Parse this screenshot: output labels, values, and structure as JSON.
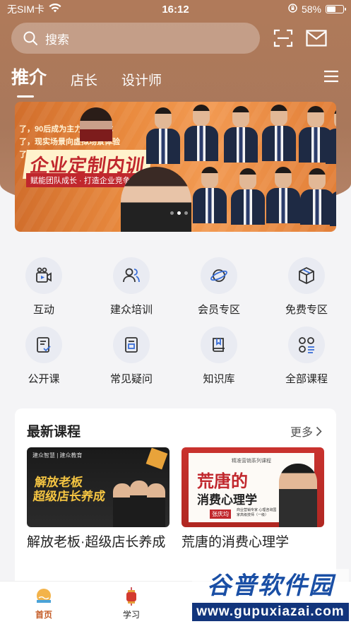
{
  "status_bar": {
    "carrier": "无SIM卡",
    "time": "16:12",
    "battery": "58%",
    "battery_level": 0.58
  },
  "search": {
    "placeholder": "搜索"
  },
  "tabs": [
    {
      "label": "推介",
      "active": true
    },
    {
      "label": "店长",
      "active": false
    },
    {
      "label": "设计师",
      "active": false
    }
  ],
  "banner": {
    "line1": "了，90后成为主力消费群体",
    "line2": "了，现实场景向虚拟场景体验",
    "line3": "了",
    "title": "企业定制内训",
    "subtitle": "赋能团队成长 · 打造企业竞争力",
    "slide_count": 3,
    "active_slide": 1
  },
  "shortcuts": [
    {
      "label": "互动",
      "icon": "video-camera-icon"
    },
    {
      "label": "建众培训",
      "icon": "users-icon"
    },
    {
      "label": "会员专区",
      "icon": "planet-icon"
    },
    {
      "label": "免费专区",
      "icon": "box-icon"
    },
    {
      "label": "公开课",
      "icon": "checklist-icon"
    },
    {
      "label": "常见疑问",
      "icon": "document-icon"
    },
    {
      "label": "知识库",
      "icon": "book-icon"
    },
    {
      "label": "全部课程",
      "icon": "categories-icon"
    }
  ],
  "latest_courses": {
    "heading": "最新课程",
    "more": "更多",
    "items": [
      {
        "title": "解放老板·超级店长养成",
        "thumb_text": "解放老板\n超级店长养成",
        "thumb_logo": "建众智慧 | 建众教育"
      },
      {
        "title": "荒唐的消费心理学",
        "thumb_top": "精准营销系列课程",
        "thumb_big": "荒唐的",
        "thumb_mid": "消费心理学",
        "thumb_name": "张庆均",
        "thumb_desc": "商业营销专家 心理咨询国家高级技师（一级）"
      }
    ]
  },
  "bottom_nav": [
    {
      "label": "首页",
      "active": true
    },
    {
      "label": "学习",
      "active": false
    }
  ],
  "watermark": {
    "top": "谷普软件园",
    "bottom": "www.gupuxiazai.com"
  },
  "colors": {
    "header_bg": "#a9785b",
    "accent": "#c45a24",
    "banner_title": "#c0272d",
    "watermark_blue": "#12357c"
  }
}
